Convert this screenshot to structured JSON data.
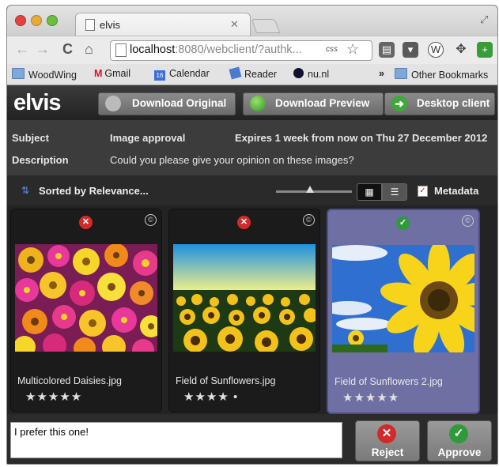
{
  "browser": {
    "tab_title": "elvis",
    "url_host": "localhost",
    "url_rest": ":8080/webclient/?authk...",
    "url_badge": "css",
    "bookmarks": [
      {
        "label": "WoodWing",
        "icon": "folder-icon"
      },
      {
        "label": "Gmail",
        "icon": "gmail-icon"
      },
      {
        "label": "Calendar",
        "icon": "calendar-icon"
      },
      {
        "label": "Reader",
        "icon": "reader-icon"
      },
      {
        "label": "nu.nl",
        "icon": "nu-icon"
      }
    ],
    "overflow": "»",
    "other_bookmarks": "Other Bookmarks",
    "calendar_date": "16"
  },
  "app": {
    "logo": "elvis",
    "buttons": {
      "download_original": "Download Original",
      "download_preview": "Download Preview",
      "desktop_client": "Desktop client"
    }
  },
  "info": {
    "subject_label": "Subject",
    "subject_value": "Image approval",
    "expires": "Expires 1 week from now on Thu 27 December 2012",
    "description_label": "Description",
    "description_value": "Could you please give your opinion on these images?"
  },
  "toolbar": {
    "sort_label": "Sorted by Relevance...",
    "metadata_label": "Metadata"
  },
  "images": [
    {
      "name": "Multicolored Daisies.jpg",
      "stars": "★★★★★",
      "status": "rejected"
    },
    {
      "name": "Field of Sunflowers.jpg",
      "stars": "★★★★ •",
      "status": "rejected"
    },
    {
      "name": "Field of Sunflowers 2.jpg",
      "stars": "★★★★★",
      "status": "approved"
    }
  ],
  "comment": {
    "value": "I prefer this one!"
  },
  "actions": {
    "reject": "Reject",
    "approve": "Approve"
  },
  "colors": {
    "reject": "#d22a2a",
    "approve": "#2f9a3a",
    "selected": "#6e6fa3"
  }
}
